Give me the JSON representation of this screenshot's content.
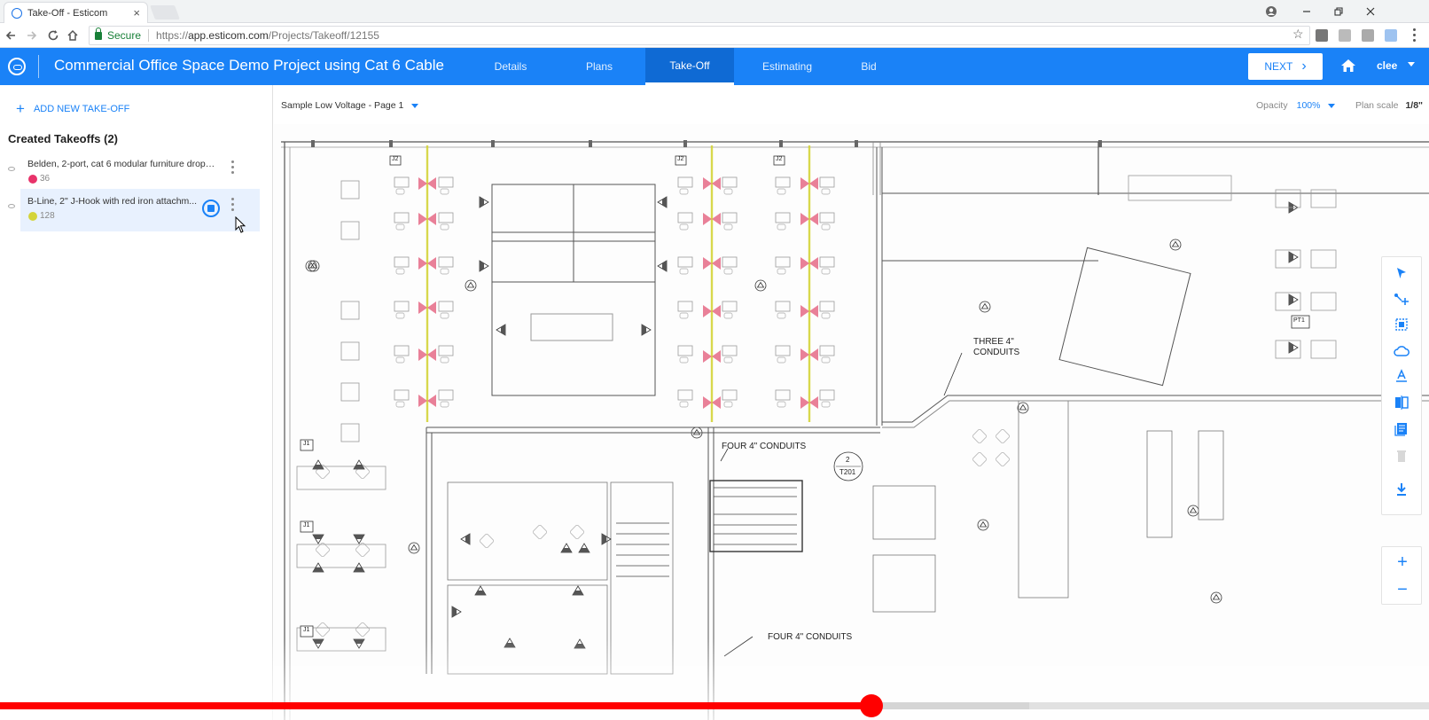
{
  "browser": {
    "tab_title": "Take-Off - Esticom",
    "tab_close": "×",
    "secure_label": "Secure",
    "url_scheme": "https://",
    "url_host": "app.esticom.com",
    "url_path": "/Projects/Takeoff/12155"
  },
  "app": {
    "project_title": "Commercial Office Space Demo Project using Cat 6 Cable",
    "tabs": [
      {
        "label": "Details"
      },
      {
        "label": "Plans"
      },
      {
        "label": "Take-Off"
      },
      {
        "label": "Estimating"
      },
      {
        "label": "Bid"
      }
    ],
    "active_tab": "Take-Off",
    "next_label": "NEXT",
    "user": "clee",
    "accent": "#1a82f7"
  },
  "sidebar": {
    "add_label": "ADD NEW TAKE-OFF",
    "created_heading": "Created Takeoffs (2)",
    "takeoffs": [
      {
        "label": "Belden, 2-port, cat 6 modular furniture drop,...",
        "count": "36",
        "color": "#e8336a"
      },
      {
        "label": "B-Line, 2\" J-Hook with red iron attachm...",
        "count": "128",
        "color": "#d4d43a"
      }
    ]
  },
  "plan": {
    "page_label": "Sample Low Voltage - Page 1",
    "opacity_label": "Opacity",
    "opacity_value": "100%",
    "scale_label": "Plan scale",
    "scale_value": "1/8\"",
    "annotations": {
      "three_conduits_1": "THREE 4\"",
      "three_conduits_2": "CONDUITS",
      "four_conduits_upper": "FOUR 4\" CONDUITS",
      "four_conduits_lower": "FOUR 4\" CONDUITS",
      "j2_a": "J2",
      "j2_b": "J2",
      "j2_c": "J2",
      "j1_a": "J1",
      "j1_b": "J1",
      "j1_c": "J1",
      "pt1": "PT1",
      "detail_num": "2",
      "detail_ref": "T201"
    }
  },
  "video": {
    "played_fraction": 0.61,
    "buffered_fraction": 0.72
  }
}
